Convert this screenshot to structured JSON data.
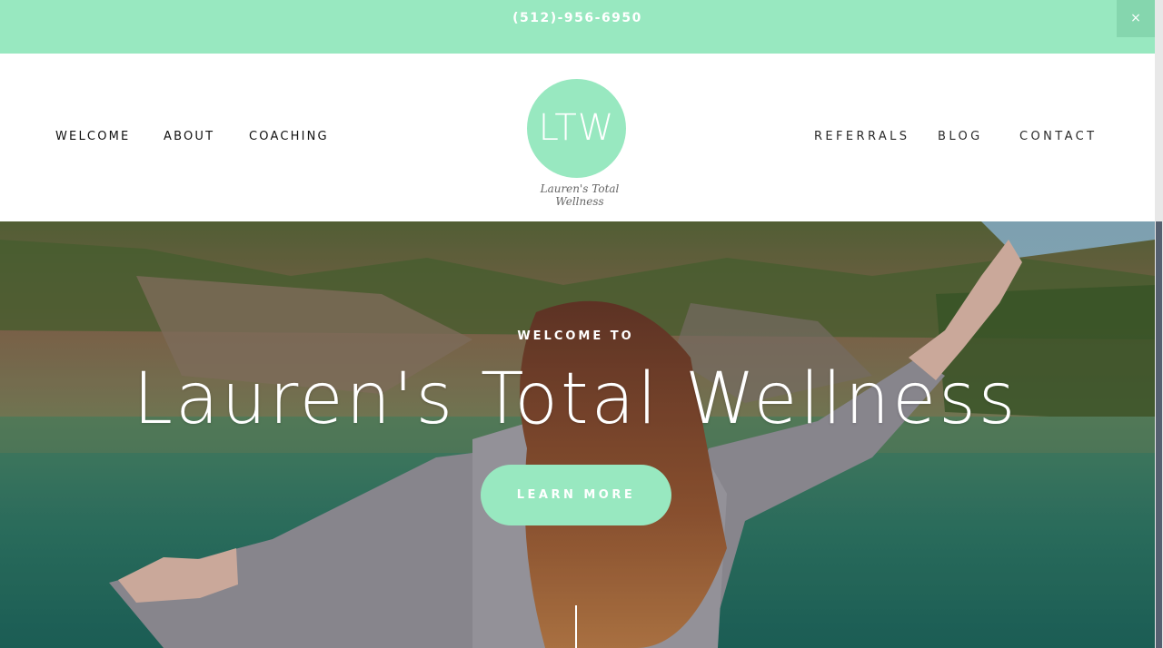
{
  "announcement": {
    "phone": "(512)-956-6950",
    "close_label": "×"
  },
  "nav": {
    "left": [
      {
        "label": "WELCOME"
      },
      {
        "label": "ABOUT"
      },
      {
        "label": "COACHING"
      }
    ],
    "right": [
      {
        "label": "REFERRALS"
      },
      {
        "label": "BLOG"
      },
      {
        "label": "CONTACT"
      }
    ]
  },
  "logo": {
    "monogram": "LTW",
    "script": "Lauren's Total Wellness"
  },
  "hero": {
    "eyebrow": "WELCOME TO",
    "title": "Lauren's Total Wellness",
    "cta_label": "LEARN MORE"
  },
  "colors": {
    "accent": "#98e8c0",
    "text": "#111111",
    "white": "#ffffff"
  }
}
